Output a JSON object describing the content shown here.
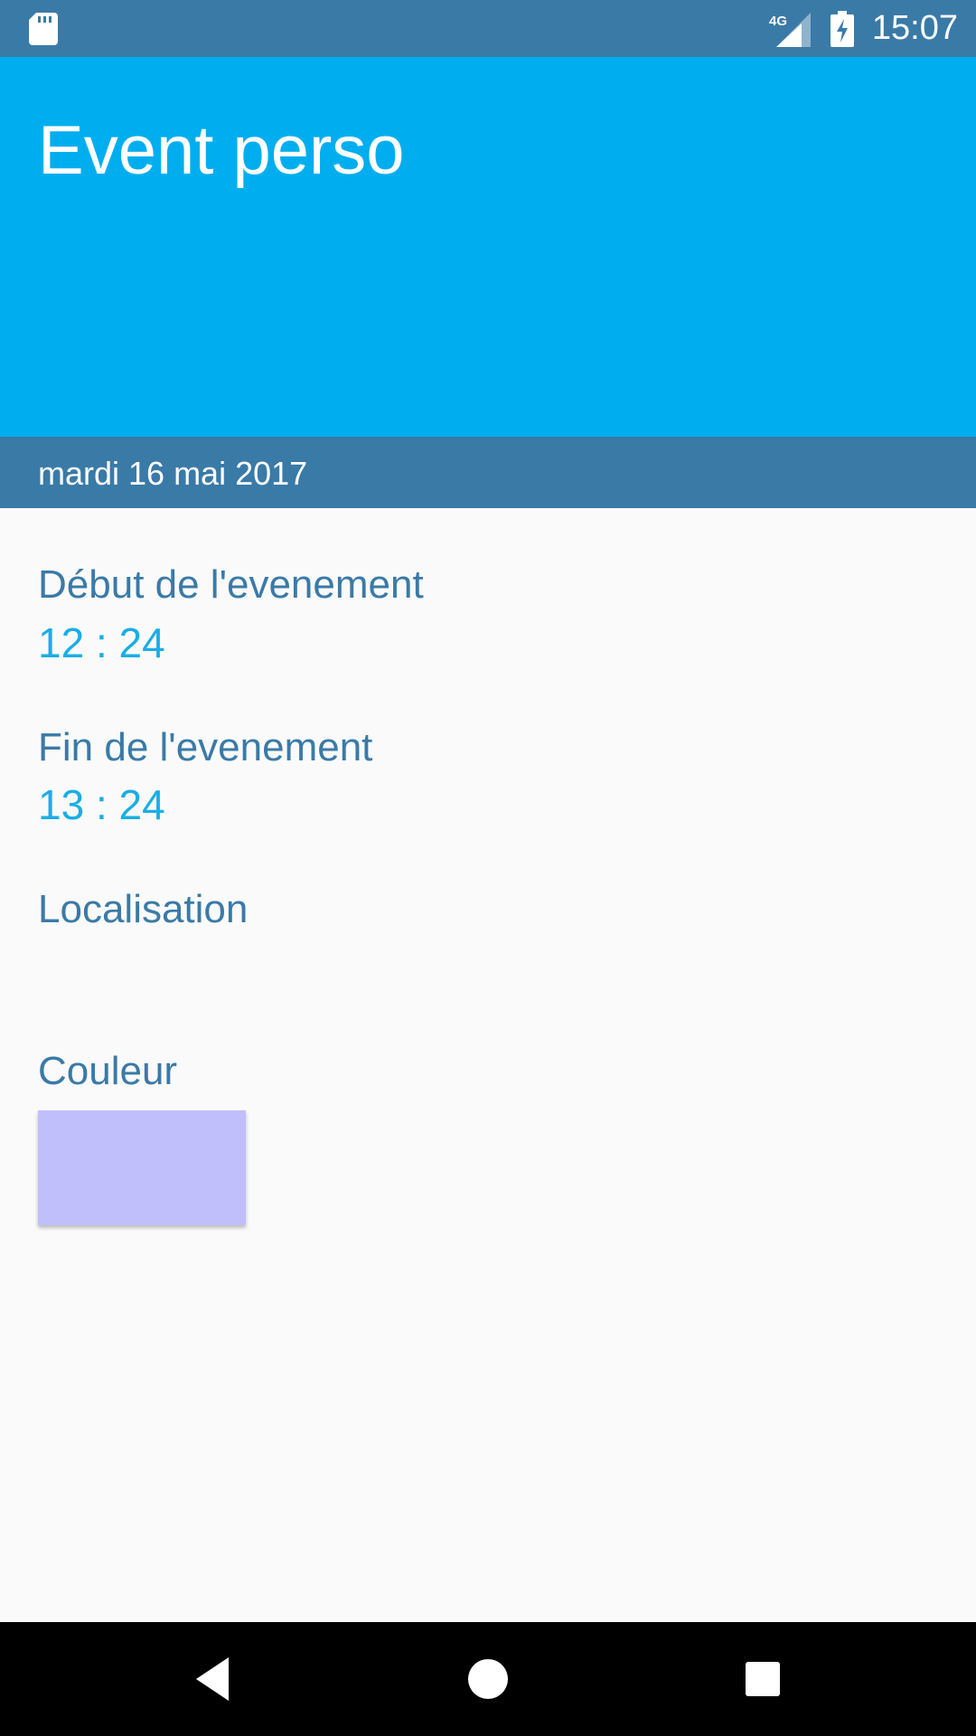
{
  "status_bar": {
    "time": "15:07",
    "network_label": "4G",
    "icons": [
      "sd-card-icon",
      "signal-4g-icon",
      "battery-charging-icon"
    ]
  },
  "event": {
    "title": "Event perso",
    "date": "mardi 16 mai 2017"
  },
  "fields": {
    "start": {
      "label": "Début de l'evenement",
      "value": "12 : 24"
    },
    "end": {
      "label": "Fin de l'evenement",
      "value": "13 : 24"
    },
    "location": {
      "label": "Localisation",
      "value": ""
    },
    "color": {
      "label": "Couleur",
      "swatch": "#c1bffb"
    }
  },
  "theme": {
    "primary": "#00aeef",
    "primary_dark": "#3a7aa7",
    "label_color": "#3a7aa7",
    "value_color": "#19aee6",
    "background": "#fafafa"
  },
  "nav_bar": {
    "icons": [
      "back-icon",
      "home-icon",
      "recents-icon"
    ]
  }
}
